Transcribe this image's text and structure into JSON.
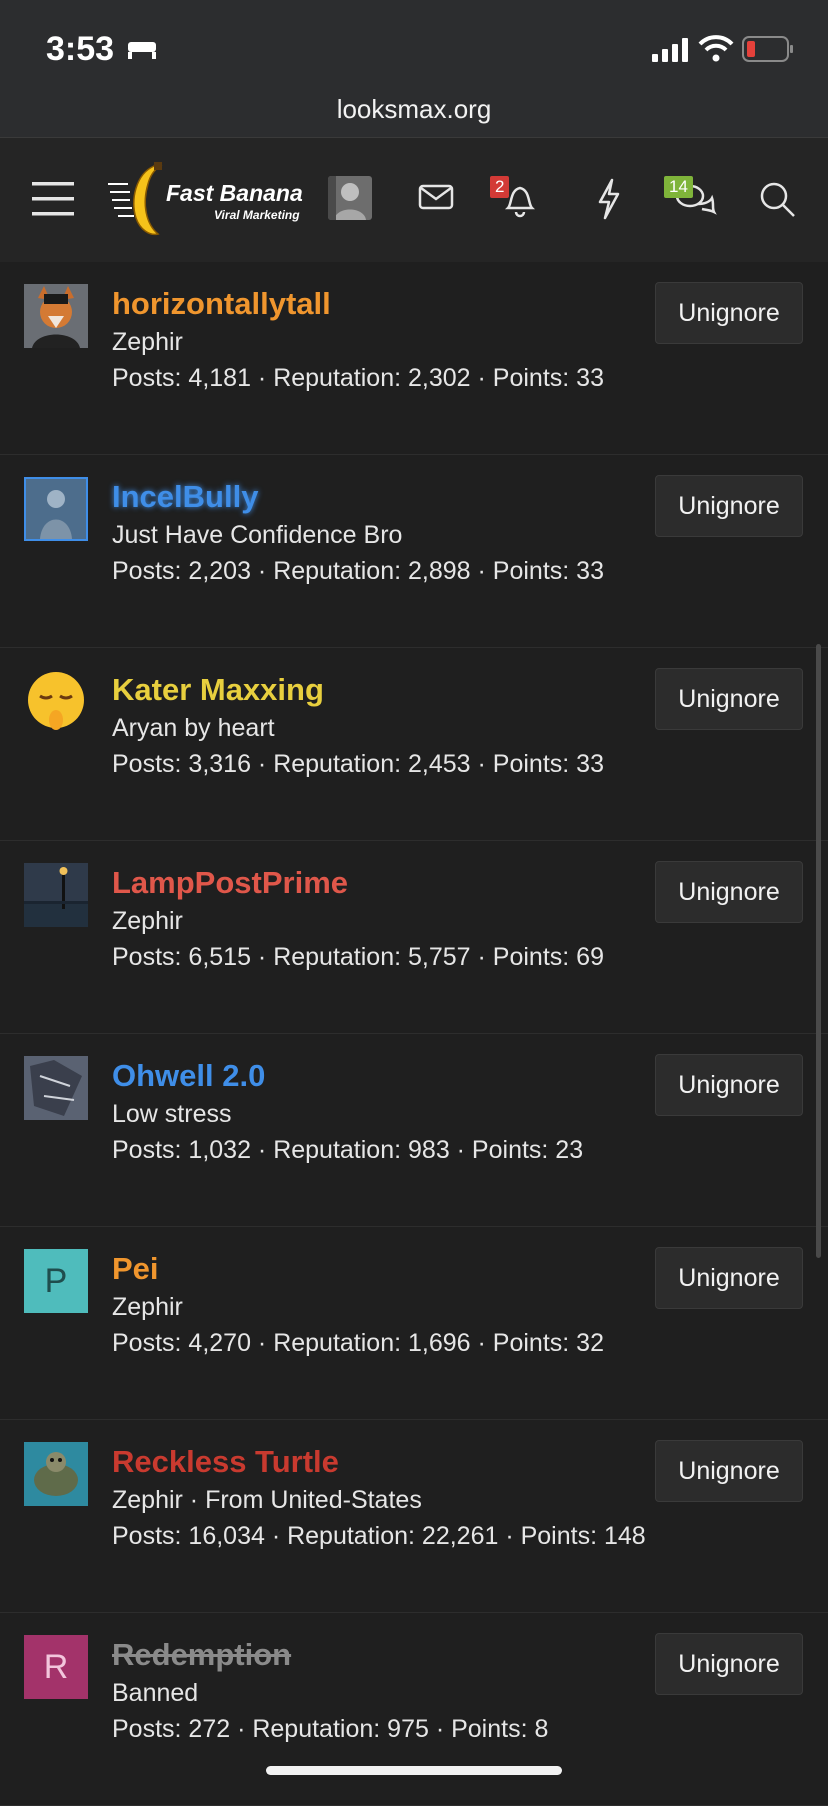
{
  "status": {
    "time": "3:53"
  },
  "browser": {
    "url": "looksmax.org"
  },
  "nav": {
    "logo_title": "Fast Banana",
    "logo_sub": "Viral Marketing",
    "alerts_count": "2",
    "conversations_count": "14"
  },
  "colors": {
    "orange": "#f0962e",
    "blue": "#3f8ee8",
    "yellow": "#e8cf3e",
    "red": "#e0574a",
    "darkred": "#c93a2f",
    "gray": "#8a8a8a"
  },
  "users": [
    {
      "name": "horizontallytall",
      "title": "Zephir",
      "stats": "Posts: 4,181 · Reputation: 2,302 · Points: 33",
      "button": "Unignore"
    },
    {
      "name": "IncelBully",
      "title": "Just Have Confidence Bro",
      "stats": "Posts: 2,203 · Reputation: 2,898 · Points: 33",
      "button": "Unignore"
    },
    {
      "name": "Kater Maxxing",
      "title": "Aryan by heart",
      "stats": "Posts: 3,316 · Reputation: 2,453 · Points: 33",
      "button": "Unignore"
    },
    {
      "name": "LampPostPrime",
      "title": "Zephir",
      "stats": "Posts: 6,515 · Reputation: 5,757 · Points: 69",
      "button": "Unignore"
    },
    {
      "name": "Ohwell 2.0",
      "title": "Low stress",
      "stats": "Posts: 1,032 · Reputation: 983 · Points: 23",
      "button": "Unignore"
    },
    {
      "name": "Pei",
      "title": "Zephir",
      "stats": "Posts: 4,270 · Reputation: 1,696 · Points: 32",
      "button": "Unignore",
      "avatar_letter": "P"
    },
    {
      "name": "Reckless Turtle",
      "title": "Zephir · From United-States",
      "stats": "Posts: 16,034 · Reputation: 22,261 · Points: 148",
      "button": "Unignore"
    },
    {
      "name": "Redemption",
      "title": "Banned",
      "stats": "Posts: 272 · Reputation: 975 · Points: 8",
      "button": "Unignore",
      "avatar_letter": "R"
    }
  ]
}
